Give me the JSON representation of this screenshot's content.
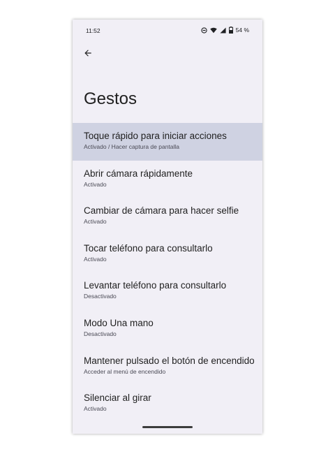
{
  "status_bar": {
    "time": "11:52",
    "battery": "54 %",
    "icons": [
      "do-not-disturb-icon",
      "wifi-icon",
      "signal-icon",
      "battery-icon"
    ]
  },
  "toolbar": {
    "back_icon": "arrow-back-icon"
  },
  "page": {
    "title": "Gestos"
  },
  "settings": [
    {
      "title": "Toque rápido para iniciar acciones",
      "summary": "Activado / Hacer captura de pantalla",
      "highlighted": true
    },
    {
      "title": "Abrir cámara rápidamente",
      "summary": "Activado",
      "highlighted": false
    },
    {
      "title": "Cambiar de cámara para hacer selfie",
      "summary": "Activado",
      "highlighted": false
    },
    {
      "title": "Tocar teléfono para consultarlo",
      "summary": "Activado",
      "highlighted": false
    },
    {
      "title": "Levantar teléfono para consultarlo",
      "summary": "Desactivado",
      "highlighted": false
    },
    {
      "title": "Modo Una mano",
      "summary": "Desactivado",
      "highlighted": false
    },
    {
      "title": "Mantener pulsado el botón de encendido",
      "summary": "Acceder al menú de encendido",
      "highlighted": false
    },
    {
      "title": "Silenciar al girar",
      "summary": "Activado",
      "highlighted": false
    }
  ],
  "colors": {
    "background": "#f1eff6",
    "highlight": "#cfd2e2",
    "text_primary": "#1f1f1f",
    "text_secondary": "#4a4a55"
  }
}
